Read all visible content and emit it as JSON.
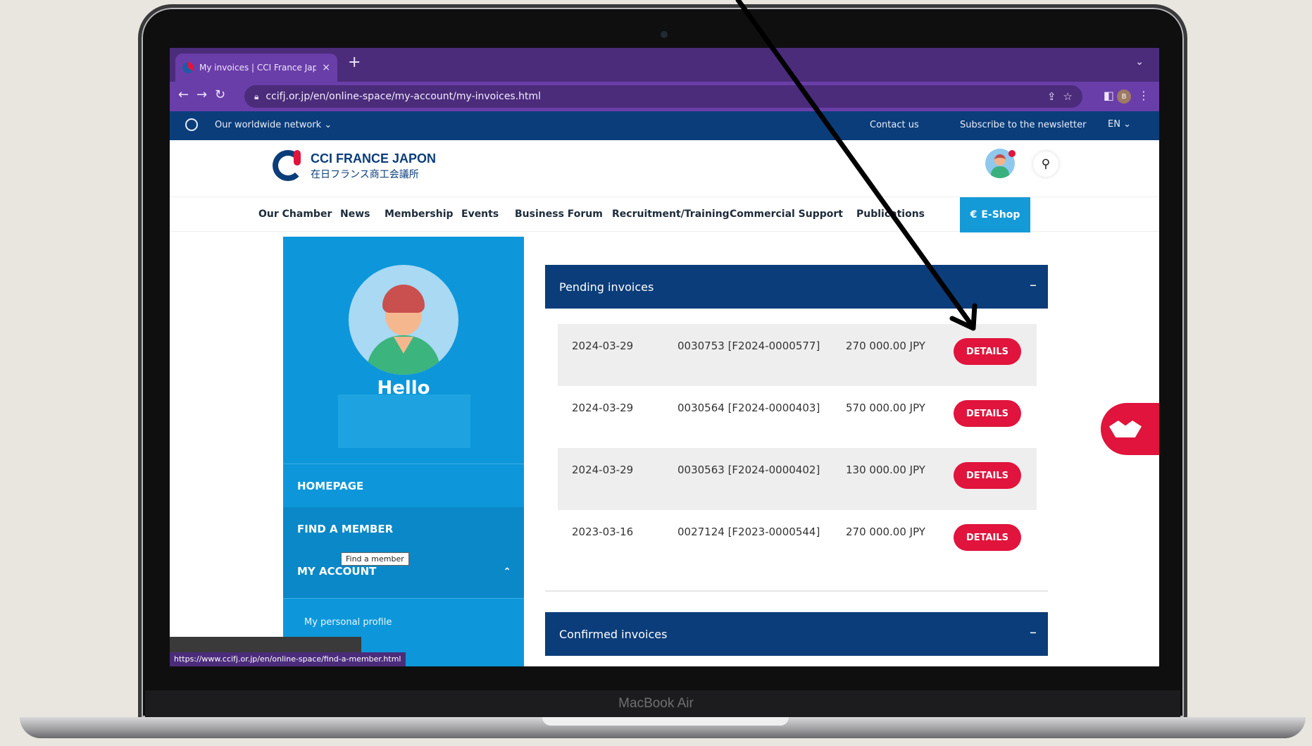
{
  "device": {
    "brand": "MacBook Air"
  },
  "browser": {
    "tab_title": "My invoices | CCI France Japon",
    "tab_close": "×",
    "new_tab": "+",
    "tab_menu": "⌄",
    "url": "ccifj.or.jp/en/online-space/my-account/my-invoices.html",
    "profile_letter": "B"
  },
  "topbar": {
    "network": "Our worldwide network",
    "contact": "Contact us",
    "newsletter": "Subscribe to the newsletter",
    "lang": "EN"
  },
  "header": {
    "logo_line1": "CCI FRANCE JAPON",
    "logo_line2": "在日フランス商工会議所"
  },
  "nav": {
    "items": [
      "Our Chamber",
      "News",
      "Membership",
      "Events",
      "Business Forum",
      "Recruitment/Training",
      "Commercial Support",
      "Publications"
    ],
    "eshop": "E-Shop"
  },
  "sidebar": {
    "hello": "Hello",
    "homepage": "HOMEPAGE",
    "find_member": "FIND A MEMBER",
    "tooltip": "Find a member",
    "my_account": "MY ACCOUNT",
    "personal_profile": "My personal profile"
  },
  "pending": {
    "title": "Pending invoices",
    "toggle": "–",
    "rows": [
      {
        "date": "2024-03-29",
        "number": "0030753 [F2024-0000577]",
        "amount": "270 000.00 JPY",
        "action": "DETAILS"
      },
      {
        "date": "2024-03-29",
        "number": "0030564 [F2024-0000403]",
        "amount": "570 000.00 JPY",
        "action": "DETAILS"
      },
      {
        "date": "2024-03-29",
        "number": "0030563 [F2024-0000402]",
        "amount": "130 000.00 JPY",
        "action": "DETAILS"
      },
      {
        "date": "2023-03-16",
        "number": "0027124 [F2023-0000544]",
        "amount": "270 000.00 JPY",
        "action": "DETAILS"
      }
    ]
  },
  "confirmed": {
    "title": "Confirmed invoices",
    "toggle": "–"
  },
  "status_bar": {
    "url": "https://www.ccifj.or.jp/en/online-space/find-a-member.html"
  },
  "colors": {
    "navy": "#0b3d7a",
    "sky": "#0d97da",
    "red": "#e0143c",
    "browser": "#6a3ea8"
  }
}
